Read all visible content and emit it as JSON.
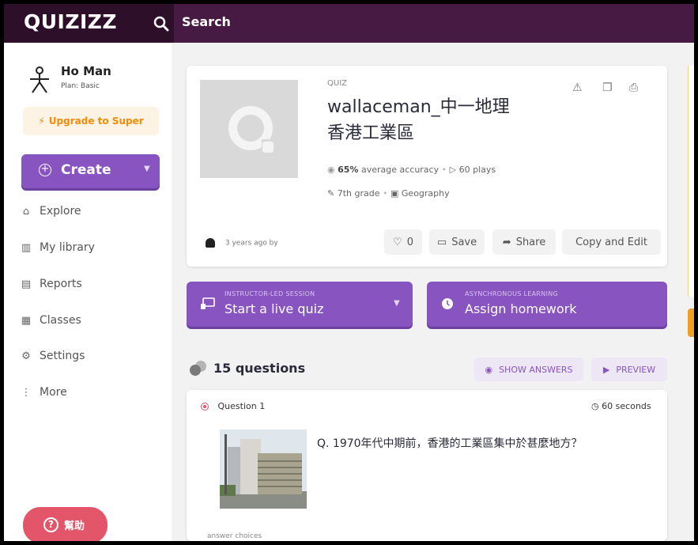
{
  "header": {
    "logo": "QUIZIZZ",
    "search_placeholder": "Search"
  },
  "sidebar": {
    "user_name": "Ho Man",
    "user_plan": "Plan: Basic",
    "upgrade_label": "Upgrade to Super",
    "create_label": "Create",
    "items": [
      {
        "label": "Explore",
        "icon": "explore-icon"
      },
      {
        "label": "My library",
        "icon": "library-icon"
      },
      {
        "label": "Reports",
        "icon": "reports-icon"
      },
      {
        "label": "Classes",
        "icon": "classes-icon"
      },
      {
        "label": "Settings",
        "icon": "settings-icon"
      },
      {
        "label": "More",
        "icon": "more-icon"
      }
    ],
    "help_label": "幫助"
  },
  "quiz": {
    "type_tag": "QUIZ",
    "title_line1": "wallaceman_中一地理",
    "title_line2": "香港工業區",
    "accuracy": "65%",
    "accuracy_suffix": "average accuracy",
    "plays": "60 plays",
    "grade": "7th grade",
    "subject": "Geography",
    "author_text": "3 years ago by",
    "likes": "0",
    "save_label": "Save",
    "share_label": "Share",
    "copy_edit_label": "Copy and Edit"
  },
  "sessions": {
    "live": {
      "small": "INSTRUCTOR-LED SESSION",
      "label": "Start a live quiz"
    },
    "homework": {
      "small": "ASYNCHRONOUS LEARNING",
      "label": "Assign homework"
    }
  },
  "questions": {
    "count_label": "15 questions",
    "show_answers_label": "SHOW ANSWERS",
    "preview_label": "PREVIEW",
    "first": {
      "number_label": "Question 1",
      "time_label": "60 seconds",
      "text": "Q. 1970年代中期前，香港的工業區集中於甚麼地方？",
      "answer_choices_label": "answer choices"
    }
  },
  "colors": {
    "topbar": "#461a42",
    "accent_purple": "#8854c0",
    "help_red": "#e3566a",
    "upgrade_orange": "#f08c0b"
  }
}
